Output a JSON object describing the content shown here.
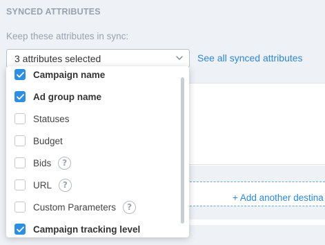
{
  "section": {
    "title": "SYNCED ATTRIBUTES",
    "sync_label": "Keep these attributes in sync:"
  },
  "select": {
    "value": "3 attributes selected",
    "icon": "chevron-down-icon"
  },
  "see_all_link": "See all synced attributes",
  "add_destination": "+ Add another destina",
  "options": [
    {
      "label": "Campaign name",
      "checked": true,
      "help": false
    },
    {
      "label": "Ad group name",
      "checked": true,
      "help": false
    },
    {
      "label": "Statuses",
      "checked": false,
      "help": false
    },
    {
      "label": "Budget",
      "checked": false,
      "help": false
    },
    {
      "label": "Bids",
      "checked": false,
      "help": true,
      "help_glyph": "?"
    },
    {
      "label": "URL",
      "checked": false,
      "help": true,
      "help_glyph": "?"
    },
    {
      "label": "Custom Parameters",
      "checked": false,
      "help": true,
      "help_glyph": "?"
    },
    {
      "label": "Campaign tracking level",
      "checked": true,
      "help": false
    }
  ],
  "colors": {
    "accent": "#2f8ee0",
    "link": "#2c87d6",
    "muted_text": "#9aa2ad",
    "background": "#eef1f5"
  }
}
